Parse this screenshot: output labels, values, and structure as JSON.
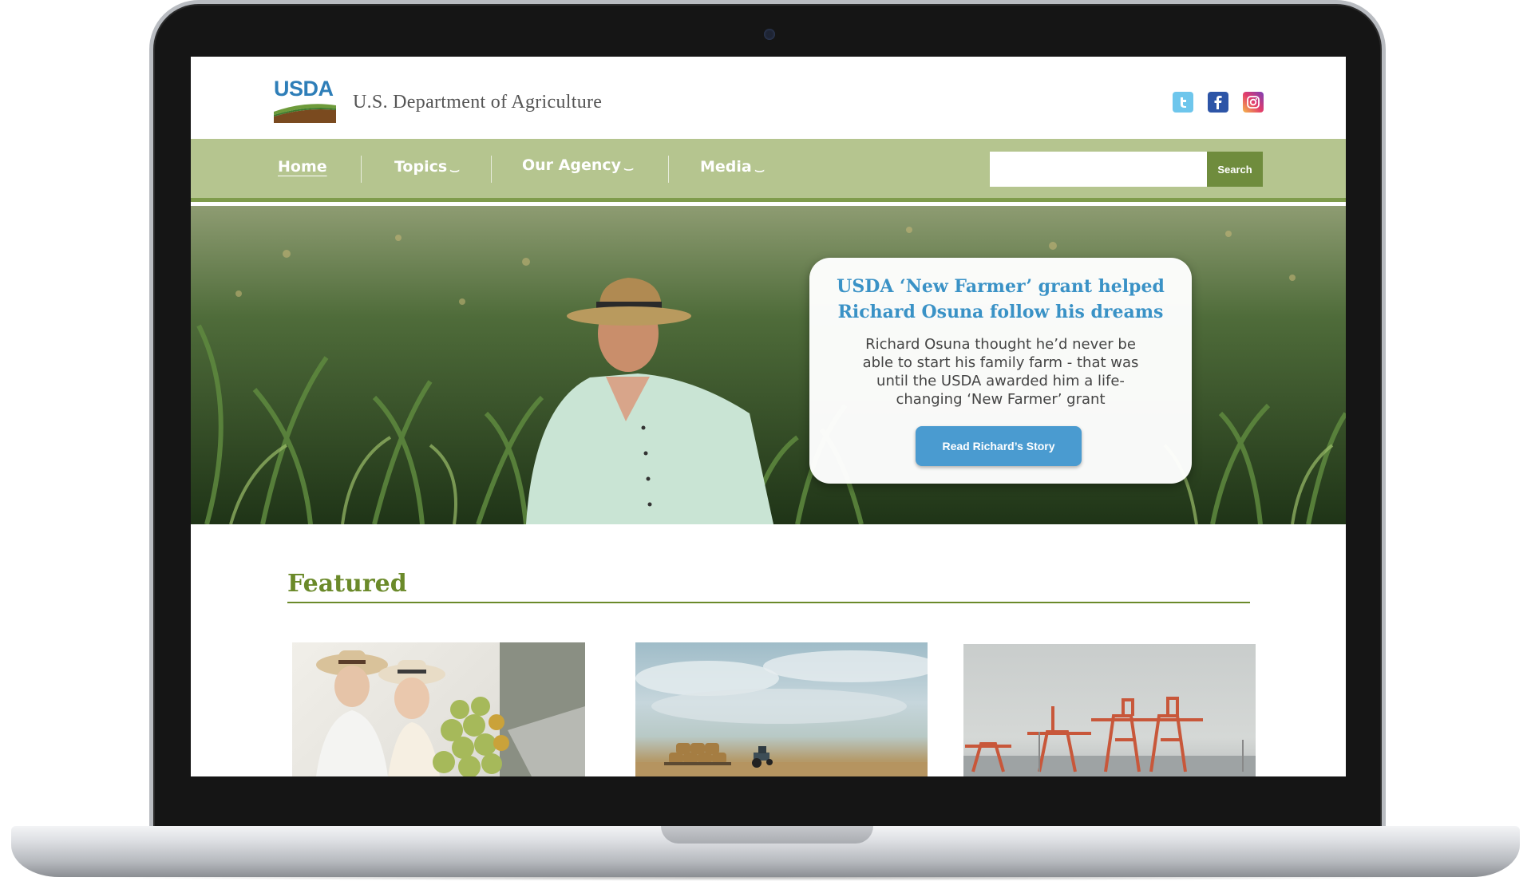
{
  "header": {
    "logo_text": "USDA",
    "site_title": "U.S. Department of Agriculture",
    "social": [
      "twitter-icon",
      "facebook-icon",
      "instagram-icon"
    ]
  },
  "nav": {
    "items": [
      {
        "label": "Home",
        "active": true
      },
      {
        "label": "Topics",
        "has_dropdown": true
      },
      {
        "label": "Our Agency",
        "has_dropdown": true
      },
      {
        "label": "Media",
        "has_dropdown": true
      }
    ],
    "search": {
      "value": "",
      "placeholder": "",
      "button_label": "Search"
    }
  },
  "hero": {
    "title": "USDA ‘New Farmer’ grant helped Richard Osuna follow his dreams",
    "body": "Richard Osuna thought he’d never be able to start his family farm - that was until the USDA awarded him a life-changing ‘New Farmer’ grant",
    "button_label": "Read Richard’s Story"
  },
  "featured": {
    "heading": "Featured",
    "items": [
      {
        "image": "couple-at-market-photo"
      },
      {
        "image": "tractor-hay-bales-photo"
      },
      {
        "image": "port-cranes-photo"
      }
    ]
  },
  "colors": {
    "nav_bg": "#b5c58f",
    "nav_border": "#7f9c4c",
    "search_button": "#6f8c3d",
    "hero_title": "#3a92c6",
    "cta_button": "#4a9bd0",
    "featured_heading": "#6b8a2a"
  }
}
